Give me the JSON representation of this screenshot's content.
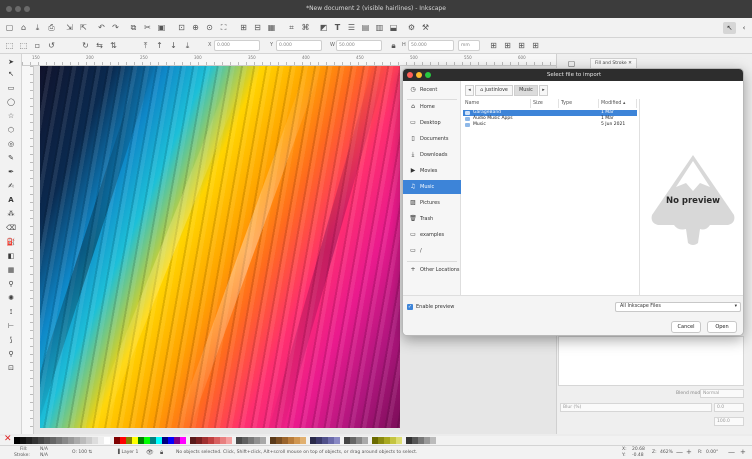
{
  "window": {
    "title": "*New document 2 (visible hairlines) - Inkscape"
  },
  "toolbar2": {
    "x_label": "X",
    "x_value": "0.000",
    "y_label": "Y",
    "y_value": "0.000",
    "w_label": "W",
    "w_value": "50.000",
    "h_label": "H",
    "h_value": "50.000",
    "unit": "mm"
  },
  "ruler": {
    "marks": [
      "150",
      "200",
      "250",
      "300",
      "350",
      "400",
      "450",
      "500",
      "550",
      "600"
    ]
  },
  "dock": {
    "tab_label": "Fill and Stroke",
    "blend_label": "Blend mode",
    "blend_value": "Normal",
    "blur_label": "Blur (%)",
    "blur_value": "0.0",
    "opacity_value": "100.0"
  },
  "dialog": {
    "title": "Select file to import",
    "places": [
      {
        "icon": "clock-icon",
        "label": "Recent"
      },
      {
        "icon": "home-icon",
        "label": "Home"
      },
      {
        "icon": "folder-icon",
        "label": "Desktop"
      },
      {
        "icon": "document-icon",
        "label": "Documents"
      },
      {
        "icon": "download-icon",
        "label": "Downloads"
      },
      {
        "icon": "video-icon",
        "label": "Movies"
      },
      {
        "icon": "music-icon",
        "label": "Music"
      },
      {
        "icon": "pictures-icon",
        "label": "Pictures"
      },
      {
        "icon": "trash-icon",
        "label": "Trash"
      },
      {
        "icon": "folder-icon",
        "label": "examples"
      },
      {
        "icon": "folder-icon",
        "label": "/"
      },
      {
        "icon": "plus-icon",
        "label": "Other Locations"
      }
    ],
    "path": {
      "home": "justinlove",
      "current": "Music"
    },
    "columns": {
      "name": "Name",
      "size": "Size",
      "type": "Type",
      "modified": "Modified"
    },
    "files": [
      {
        "name": "GarageBand",
        "size": "",
        "type": "",
        "modified": "1 Mar"
      },
      {
        "name": "Audio Music Apps",
        "size": "",
        "type": "",
        "modified": "1 Mar"
      },
      {
        "name": "Music",
        "size": "",
        "type": "",
        "modified": "5 Jun 2021"
      }
    ],
    "preview_text": "No preview",
    "enable_preview_label": "Enable preview",
    "filter_value": "All Inkscape Files",
    "cancel_label": "Cancel",
    "open_label": "Open"
  },
  "status": {
    "fill_label": "Fill:",
    "fill_value": "N/A",
    "stroke_label": "Stroke:",
    "stroke_value": "N/A",
    "layer_label": "Layer 1",
    "message": "No objects selected. Click, Shift+click, Alt+scroll mouse on top of objects, or drag around objects to select.",
    "coord_x_label": "X:",
    "coord_x": "20.68",
    "coord_y_label": "Y:",
    "coord_y": "-0.48",
    "zoom_label": "Z:",
    "zoom": "462%",
    "rotate_label": "R:",
    "rotate": "0.00°"
  },
  "colors": {
    "accent": "#3d84d8",
    "titlebar": "#3c3c3c"
  }
}
